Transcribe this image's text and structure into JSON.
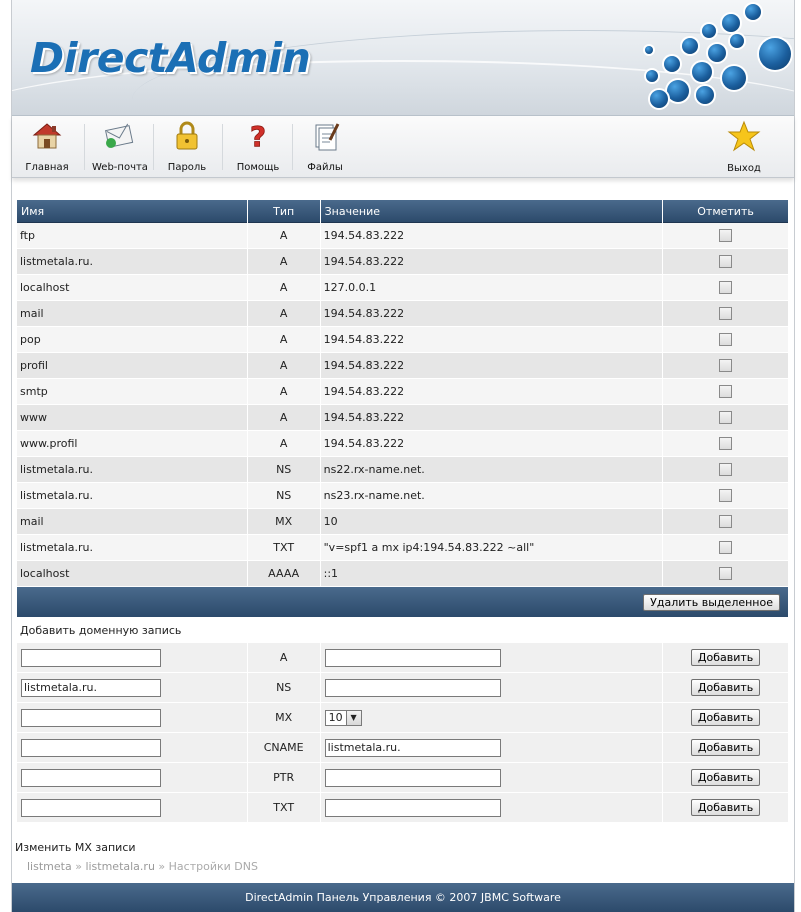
{
  "header": {
    "logo_text": "DirectAdmin"
  },
  "toolbar": {
    "items": [
      {
        "label": "Главная",
        "icon": "home-icon"
      },
      {
        "label": "Web-почта",
        "icon": "webmail-icon"
      },
      {
        "label": "Пароль",
        "icon": "lock-icon"
      },
      {
        "label": "Помощь",
        "icon": "help-icon"
      },
      {
        "label": "Файлы",
        "icon": "files-icon"
      },
      {
        "label": "Выход",
        "icon": "star-icon"
      }
    ]
  },
  "table": {
    "headers": {
      "name": "Имя",
      "type": "Тип",
      "value": "Значение",
      "select": "Отметить"
    },
    "rows": [
      {
        "name": "ftp",
        "type": "A",
        "value": "194.54.83.222"
      },
      {
        "name": "listmetala.ru.",
        "type": "A",
        "value": "194.54.83.222"
      },
      {
        "name": "localhost",
        "type": "A",
        "value": "127.0.0.1"
      },
      {
        "name": "mail",
        "type": "A",
        "value": "194.54.83.222"
      },
      {
        "name": "pop",
        "type": "A",
        "value": "194.54.83.222"
      },
      {
        "name": "profil",
        "type": "A",
        "value": "194.54.83.222"
      },
      {
        "name": "smtp",
        "type": "A",
        "value": "194.54.83.222"
      },
      {
        "name": "www",
        "type": "A",
        "value": "194.54.83.222"
      },
      {
        "name": "www.profil",
        "type": "A",
        "value": "194.54.83.222"
      },
      {
        "name": "listmetala.ru.",
        "type": "NS",
        "value": "ns22.rx-name.net."
      },
      {
        "name": "listmetala.ru.",
        "type": "NS",
        "value": "ns23.rx-name.net."
      },
      {
        "name": "mail",
        "type": "MX",
        "value": "10"
      },
      {
        "name": "listmetala.ru.",
        "type": "TXT",
        "value": "\"v=spf1 a mx ip4:194.54.83.222 ~all\""
      },
      {
        "name": "localhost",
        "type": "AAAA",
        "value": "::1"
      }
    ],
    "delete_button": "Удалить выделенное"
  },
  "add": {
    "title": "Добавить доменную запись",
    "button": "Добавить",
    "rows": [
      {
        "type": "A",
        "name_value": "",
        "value_value": ""
      },
      {
        "type": "NS",
        "name_value": "listmetala.ru.",
        "value_value": ""
      },
      {
        "type": "MX",
        "name_value": "",
        "select_value": "10"
      },
      {
        "type": "CNAME",
        "name_value": "",
        "value_value": "listmetala.ru."
      },
      {
        "type": "PTR",
        "name_value": "",
        "value_value": ""
      },
      {
        "type": "TXT",
        "name_value": "",
        "value_value": ""
      }
    ]
  },
  "links": {
    "change_mx": "Изменить MX записи"
  },
  "breadcrumb": {
    "items": [
      "listmeta",
      "listmetala.ru",
      "Настройки DNS"
    ],
    "separator": "»"
  },
  "footer": {
    "text": "DirectAdmin Панель Управления © 2007 JBMC Software"
  }
}
